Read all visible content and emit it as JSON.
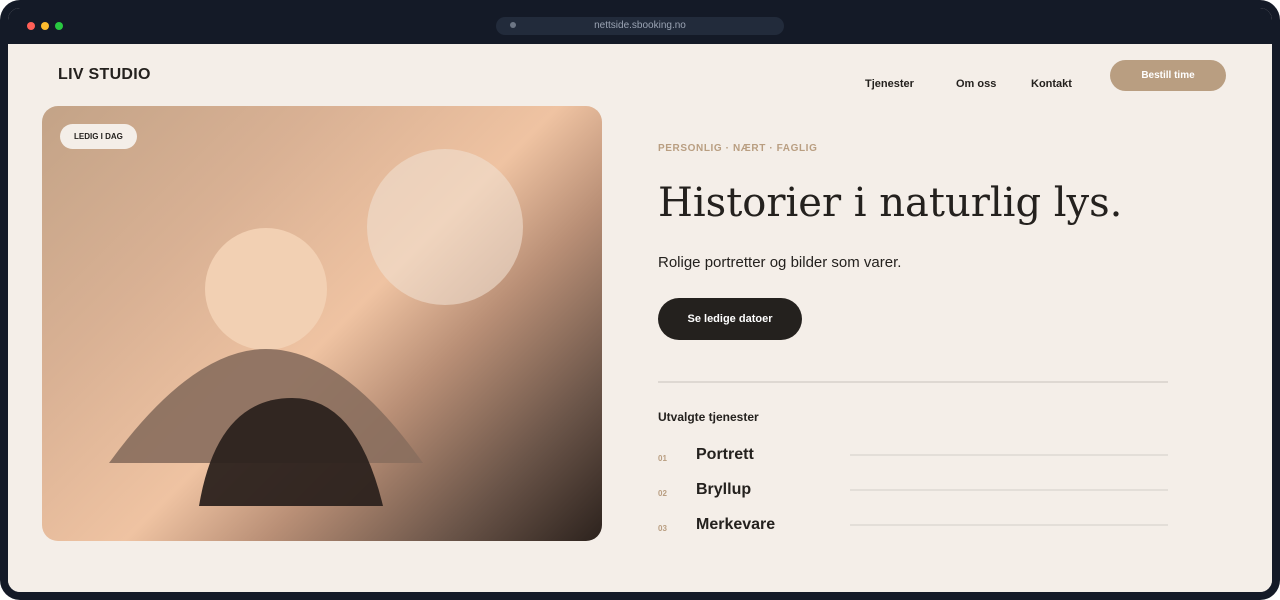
{
  "browser": {
    "url": "nettside.sbooking.no"
  },
  "site": {
    "logo": "LIV STUDIO"
  },
  "nav": {
    "items": [
      "Tjenester",
      "Om oss",
      "Kontakt"
    ],
    "cta": "Bestill time"
  },
  "hero": {
    "badge": "LEDIG I DAG",
    "tagline": "PERSONLIG · NÆRT · FAGLIG",
    "headline": "Historier i naturlig lys.",
    "subline": "Rolige portretter og bilder som varer.",
    "cta": "Se ledige datoer"
  },
  "services": {
    "title": "Utvalgte tjenester",
    "items": [
      {
        "num": "01",
        "name": "Portrett"
      },
      {
        "num": "02",
        "name": "Bryllup"
      },
      {
        "num": "03",
        "name": "Merkevare"
      }
    ]
  },
  "colors": {
    "accent": "#b99e81",
    "dark": "#24211e",
    "background": "#f4eee8",
    "chrome": "#141a27"
  }
}
